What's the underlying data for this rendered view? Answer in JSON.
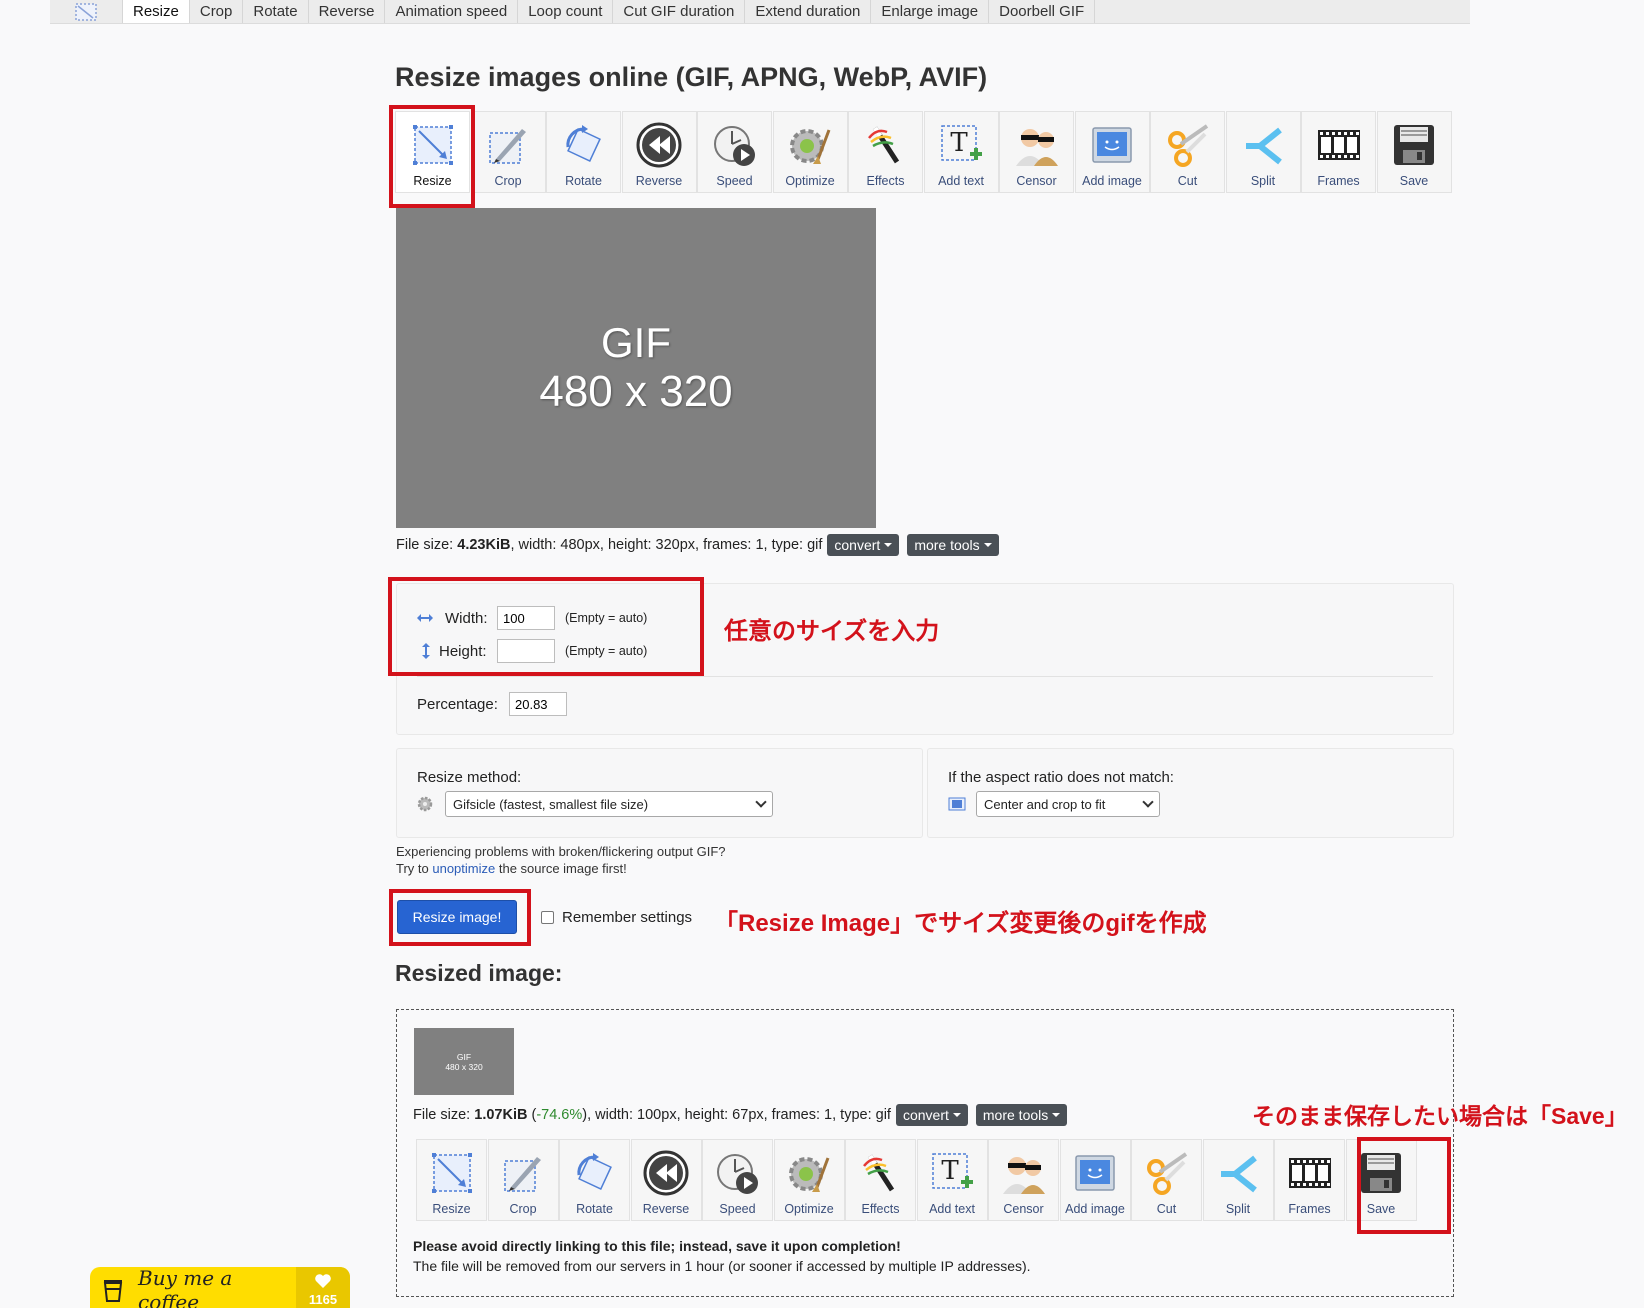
{
  "nav": {
    "tabs": [
      "Resize",
      "Crop",
      "Rotate",
      "Reverse",
      "Animation speed",
      "Loop count",
      "Cut GIF duration",
      "Extend duration",
      "Enlarge image",
      "Doorbell GIF"
    ]
  },
  "page_title": "Resize images online (GIF, APNG, WebP, AVIF)",
  "tools": [
    "Resize",
    "Crop",
    "Rotate",
    "Reverse",
    "Speed",
    "Optimize",
    "Effects",
    "Add text",
    "Censor",
    "Add image",
    "Cut",
    "Split",
    "Frames",
    "Save"
  ],
  "preview": {
    "line1": "GIF",
    "line2": "480 x 320"
  },
  "file_info": {
    "prefix": "File size: ",
    "size": "4.23KiB",
    "rest": ", width: 480px, height: 320px, frames: 1, type: gif",
    "convert": "convert",
    "more_tools": "more tools"
  },
  "size_form": {
    "width_label": "Width:",
    "width_value": "100",
    "height_label": "Height:",
    "height_value": "",
    "hint": "(Empty = auto)",
    "percentage_label": "Percentage:",
    "percentage_value": "20.83"
  },
  "method": {
    "label": "Resize method:",
    "selected": "Gifsicle (fastest, smallest file size)"
  },
  "aspect": {
    "label": "If the aspect ratio does not match:",
    "selected": "Center and crop to fit"
  },
  "help": {
    "line1": "Experiencing problems with broken/flickering output GIF?",
    "line2_prefix": "Try to ",
    "line2_link": "unoptimize",
    "line2_suffix": " the source image first!"
  },
  "resize_button": "Resize image!",
  "remember": "Remember settings",
  "annotations": {
    "size_note": "任意のサイズを入力",
    "resize_note": "「Resize Image」でサイズ変更後のgifを作成",
    "save_note": "そのまま保存したい場合は「Save」"
  },
  "resized": {
    "title": "Resized image:",
    "thumb_line1": "GIF",
    "thumb_line2": "480 x 320",
    "prefix": "File size: ",
    "size": "1.07KiB",
    "open": " (",
    "change": "-74.6%",
    "rest": "), width: 100px, height: 67px, frames: 1, type: gif",
    "convert": "convert",
    "more_tools": "more tools",
    "warning": "Please avoid directly linking to this file; instead, save it upon completion!",
    "removal": "The file will be removed from our servers in 1 hour (or sooner if accessed by multiple IP addresses)."
  },
  "bmc": {
    "text": "Buy me a coffee",
    "count": "1165"
  },
  "colors": {
    "accent": "#2764d2",
    "highlight": "#d3121b",
    "bmc": "#ffdd00"
  }
}
